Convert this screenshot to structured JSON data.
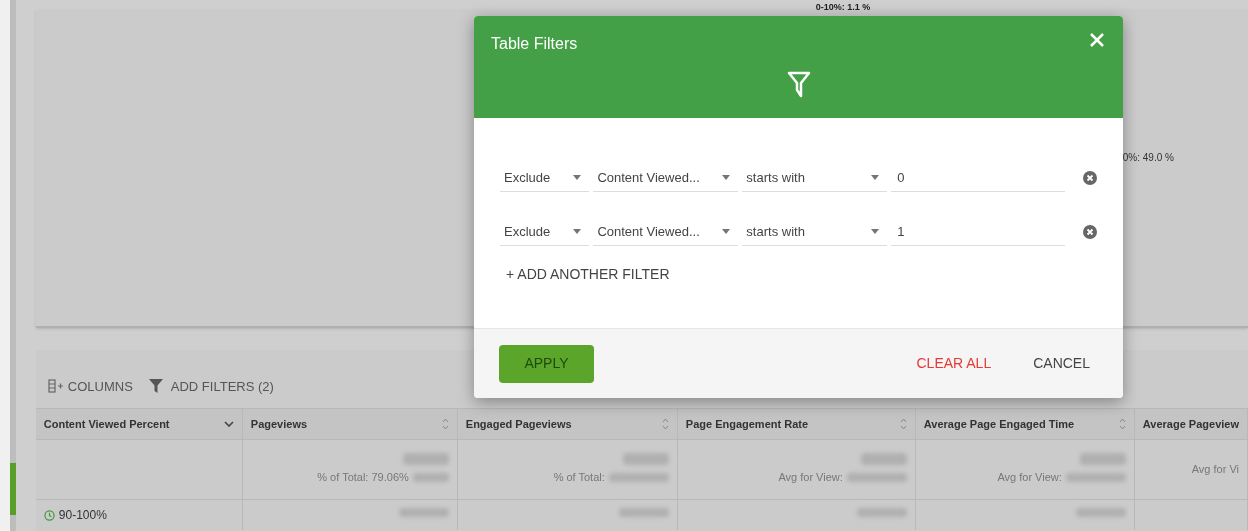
{
  "chart": {
    "labels": [
      "0-10%: 1.1 %",
      "0%: 49.0 %"
    ]
  },
  "toolbar": {
    "columns": "COLUMNS",
    "filters": "ADD FILTERS (2)"
  },
  "table": {
    "columns": [
      {
        "label": "Content Viewed Percent",
        "kind": "dimension"
      },
      {
        "label": "Pageviews",
        "kind": "metric"
      },
      {
        "label": "Engaged Pageviews",
        "kind": "metric"
      },
      {
        "label": "Page Engagement Rate",
        "kind": "metric"
      },
      {
        "label": "Average Page Engaged Time",
        "kind": "metric"
      },
      {
        "label": "Average Pageview",
        "kind": "cut"
      }
    ],
    "totals": [
      "% of Total: 79.06%",
      "% of Total:",
      "Avg for View:",
      "Avg for View:",
      "Avg for Vi"
    ],
    "rows": [
      {
        "label": "90-100%"
      }
    ]
  },
  "dialog": {
    "title": "Table Filters",
    "filters": [
      {
        "mode": "Exclude",
        "field": "Content Viewed...",
        "operator": "starts with",
        "value": "0"
      },
      {
        "mode": "Exclude",
        "field": "Content Viewed...",
        "operator": "starts with",
        "value": "1"
      }
    ],
    "add_filter": "+ ADD ANOTHER FILTER",
    "apply": {
      "label": "APPLY",
      "disabled": true
    },
    "clear": "CLEAR ALL",
    "cancel": "CANCEL"
  }
}
